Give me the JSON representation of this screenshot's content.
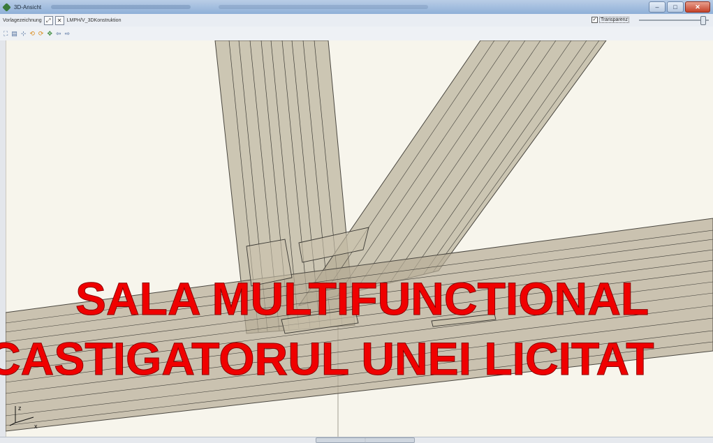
{
  "window": {
    "title": "3D-Ansicht",
    "buttons": {
      "minimize": "–",
      "maximize": "□",
      "close": "✕"
    }
  },
  "toolbar1": {
    "label": "Vorlagezeichnung",
    "path": "LMPH/V_3DKonstruktion",
    "transparency_label": "Transparenz",
    "transparency_checked": "✓"
  },
  "toolbar2": {
    "icons": [
      "zoom-extents-icon",
      "print-icon",
      "axis-icon",
      "rotate-left-icon",
      "rotate-right-icon",
      "move-icon",
      "back-icon",
      "forward-icon"
    ]
  },
  "overlay": {
    "line1": "SALA MULTIFUNCTIONAL",
    "line2": "CASTIGATORUL UNEI LICITAT"
  },
  "axes": {
    "z": "z",
    "x": "x"
  },
  "colors": {
    "overlay_text": "#f00000",
    "beam_fill": "#b9b09a",
    "viewport_bg": "#f7f5ec"
  }
}
